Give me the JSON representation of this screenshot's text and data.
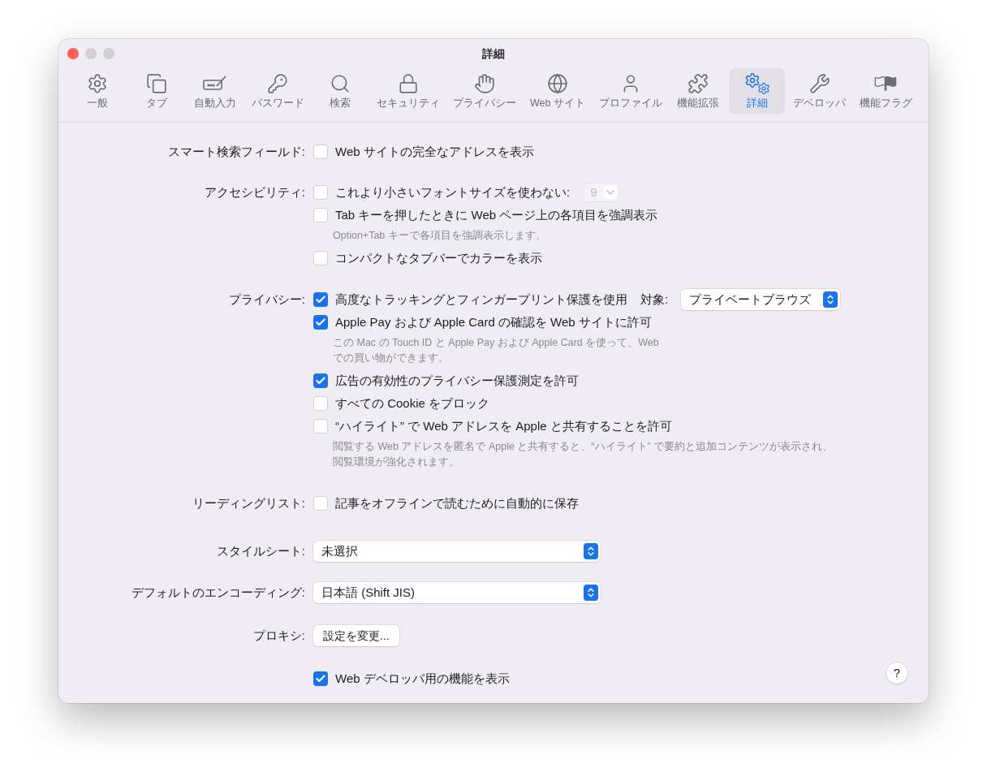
{
  "window": {
    "title": "詳細"
  },
  "toolbar": [
    {
      "label": "一般",
      "selected": false
    },
    {
      "label": "タブ",
      "selected": false
    },
    {
      "label": "自動入力",
      "selected": false
    },
    {
      "label": "パスワード",
      "selected": false
    },
    {
      "label": "検索",
      "selected": false
    },
    {
      "label": "セキュリティ",
      "selected": false
    },
    {
      "label": "プライバシー",
      "selected": false
    },
    {
      "label": "Web サイト",
      "selected": false
    },
    {
      "label": "プロファイル",
      "selected": false
    },
    {
      "label": "機能拡張",
      "selected": false
    },
    {
      "label": "詳細",
      "selected": true
    },
    {
      "label": "デベロッパ",
      "selected": false
    },
    {
      "label": "機能フラグ",
      "selected": false
    }
  ],
  "sections": [
    {
      "label": "スマート検索フィールド:",
      "items": [
        {
          "kind": "checkbox",
          "label": "Web サイトの完全なアドレスを表示",
          "checked": false
        }
      ]
    },
    {
      "label": "アクセシビリティ:",
      "items": [
        {
          "kind": "checkbox",
          "label": "これより小さいフォントサイズを使わない:",
          "checked": false,
          "stepper": {
            "value": "9",
            "disabled": true
          }
        },
        {
          "kind": "checkbox",
          "label": "Tab キーを押したときに Web ページ上の各項目を強調表示",
          "checked": false,
          "note": [
            "Option+Tab キーで各項目を強調表示します。"
          ]
        },
        {
          "kind": "checkbox",
          "label": "コンパクトなタブバーでカラーを表示",
          "checked": false
        }
      ]
    },
    {
      "label": "プライバシー:",
      "items": [
        {
          "kind": "checkbox",
          "label": "高度なトラッキングとフィンガープリント保護を使用",
          "checked": true,
          "popup": {
            "label": "対象:",
            "value": "プライベートブラウズ"
          }
        },
        {
          "kind": "checkbox",
          "label": "Apple Pay および Apple Card の確認を Web サイトに許可",
          "checked": true,
          "note": [
            "この Mac の Touch ID と Apple Pay および Apple Card を使って、Web",
            "での買い物ができます。"
          ]
        },
        {
          "kind": "checkbox",
          "label": "広告の有効性のプライバシー保護測定を許可",
          "checked": true
        },
        {
          "kind": "checkbox",
          "label": "すべての Cookie をブロック",
          "checked": false
        },
        {
          "kind": "checkbox",
          "label": "“ハイライト” で Web アドレスを Apple と共有することを許可",
          "checked": false,
          "note": [
            "閲覧する Web アドレスを匿名で Apple と共有すると、“ハイライト” で要約と追加コンテンツが表示され、",
            "閲覧環境が強化されます。"
          ]
        }
      ]
    },
    {
      "label": "リーディングリスト:",
      "items": [
        {
          "kind": "checkbox",
          "label": "記事をオフラインで読むために自動的に保存",
          "checked": false
        }
      ]
    },
    {
      "label": "スタイルシート:",
      "items": [
        {
          "kind": "select",
          "value": "未選択"
        }
      ]
    },
    {
      "label": "デフォルトのエンコーディング:",
      "items": [
        {
          "kind": "select",
          "value": "日本語 (Shift JIS)"
        }
      ]
    },
    {
      "label": "プロキシ:",
      "items": [
        {
          "kind": "button",
          "label": "設定を変更..."
        }
      ]
    },
    {
      "items": [
        {
          "kind": "checkbox",
          "label": "Web デベロッパ用の機能を表示",
          "checked": true
        }
      ]
    }
  ],
  "help": {
    "label": "?"
  }
}
